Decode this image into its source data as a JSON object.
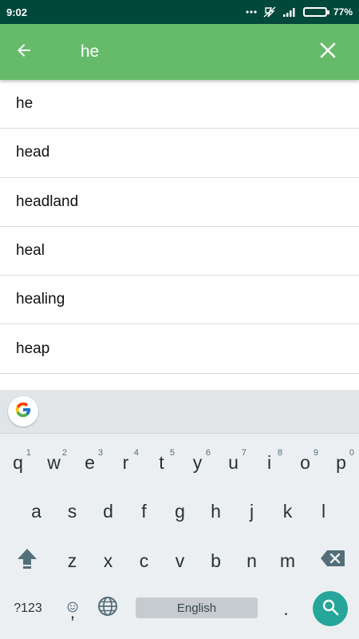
{
  "status_bar": {
    "time": "9:02",
    "battery_percent": "77%",
    "battery_level": 0.77,
    "icons": [
      "more-dots-icon",
      "mute-icon",
      "signal-icon",
      "battery-icon"
    ]
  },
  "app_bar": {
    "background": "#66bb6a",
    "back_icon": "arrow-left-icon",
    "search_value": "he",
    "clear_icon": "close-icon"
  },
  "suggestions": [
    "he",
    "head",
    "headland",
    "heal",
    "healing",
    "heap"
  ],
  "keyboard": {
    "google_icon": "google-g-icon",
    "rows": [
      [
        {
          "label": "q",
          "hint": "1"
        },
        {
          "label": "w",
          "hint": "2"
        },
        {
          "label": "e",
          "hint": "3"
        },
        {
          "label": "r",
          "hint": "4"
        },
        {
          "label": "t",
          "hint": "5"
        },
        {
          "label": "y",
          "hint": "6"
        },
        {
          "label": "u",
          "hint": "7"
        },
        {
          "label": "i",
          "hint": "8"
        },
        {
          "label": "o",
          "hint": "9"
        },
        {
          "label": "p",
          "hint": "0"
        }
      ],
      [
        {
          "label": "a"
        },
        {
          "label": "s"
        },
        {
          "label": "d"
        },
        {
          "label": "f"
        },
        {
          "label": "g"
        },
        {
          "label": "h"
        },
        {
          "label": "j"
        },
        {
          "label": "k"
        },
        {
          "label": "l"
        }
      ],
      [
        {
          "label": "z"
        },
        {
          "label": "x"
        },
        {
          "label": "c"
        },
        {
          "label": "v"
        },
        {
          "label": "b"
        },
        {
          "label": "n"
        },
        {
          "label": "m"
        }
      ]
    ],
    "shift_icon": "shift-arrow-icon",
    "backspace_icon": "backspace-icon",
    "symbols_label": "?123",
    "comma_label": ",",
    "emoji_icon": "emoji-icon",
    "globe_icon": "globe-icon",
    "space_label": "English",
    "period_label": ".",
    "search_icon": "search-icon",
    "accent_color": "#26a69a"
  }
}
